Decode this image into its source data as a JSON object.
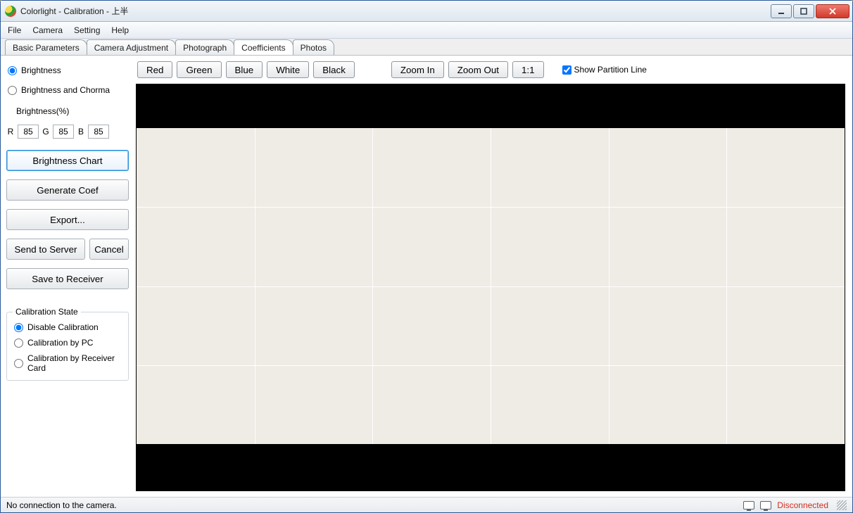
{
  "window": {
    "title": "Colorlight - Calibration      - 上半"
  },
  "menu": {
    "file": "File",
    "camera": "Camera",
    "setting": "Setting",
    "help": "Help"
  },
  "tabs": {
    "basic": "Basic Parameters",
    "camera_adj": "Camera Adjustment",
    "photograph": "Photograph",
    "coefficients": "Coefficients",
    "photos": "Photos"
  },
  "left": {
    "mode_brightness": "Brightness",
    "mode_brightness_chroma": "Brightness and Chorma",
    "brightness_pct_label": "Brightness(%)",
    "r_label": "R",
    "g_label": "G",
    "b_label": "B",
    "r_val": "85",
    "g_val": "85",
    "b_val": "85",
    "btn_brightness_chart": "Brightness Chart",
    "btn_generate_coef": "Generate Coef",
    "btn_export": "Export...",
    "btn_send_server": "Send to Server",
    "btn_cancel": "Cancel",
    "btn_save_receiver": "Save to Receiver",
    "group_title": "Calibration State",
    "opt_disable": "Disable Calibration",
    "opt_by_pc": "Calibration by PC",
    "opt_by_card": "Calibration by Receiver Card"
  },
  "toolbar": {
    "red": "Red",
    "green": "Green",
    "blue": "Blue",
    "white": "White",
    "black": "Black",
    "zoom_in": "Zoom In",
    "zoom_out": "Zoom Out",
    "one_to_one": "1:1",
    "show_partition": "Show Partition Line"
  },
  "status": {
    "left": "No connection to the camera.",
    "disconnected": "Disconnected"
  }
}
